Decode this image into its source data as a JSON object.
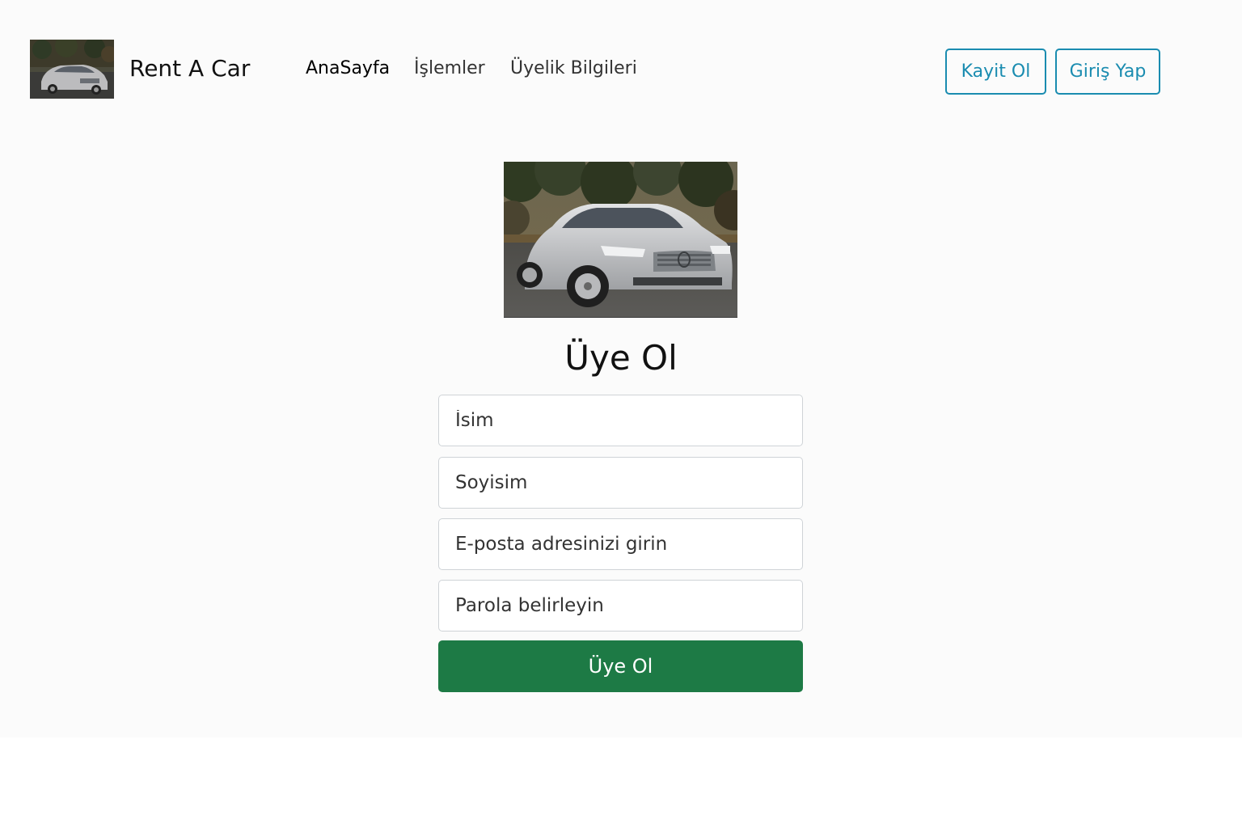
{
  "navbar": {
    "brand_text": "Rent A Car",
    "links": {
      "home": "AnaSayfa",
      "operations": "İşlemler",
      "membership": "Üyelik Bilgileri"
    },
    "register_button": "Kayit Ol",
    "login_button": "Giriş Yap"
  },
  "form": {
    "title": "Üye Ol",
    "first_name_placeholder": "İsim",
    "last_name_placeholder": "Soyisim",
    "email_placeholder": "E-posta adresinizi girin",
    "password_placeholder": "Parola belirleyin",
    "submit_label": "Üye Ol"
  },
  "colors": {
    "accent": "#1a8cb0",
    "submit_green": "#1d7a45"
  }
}
